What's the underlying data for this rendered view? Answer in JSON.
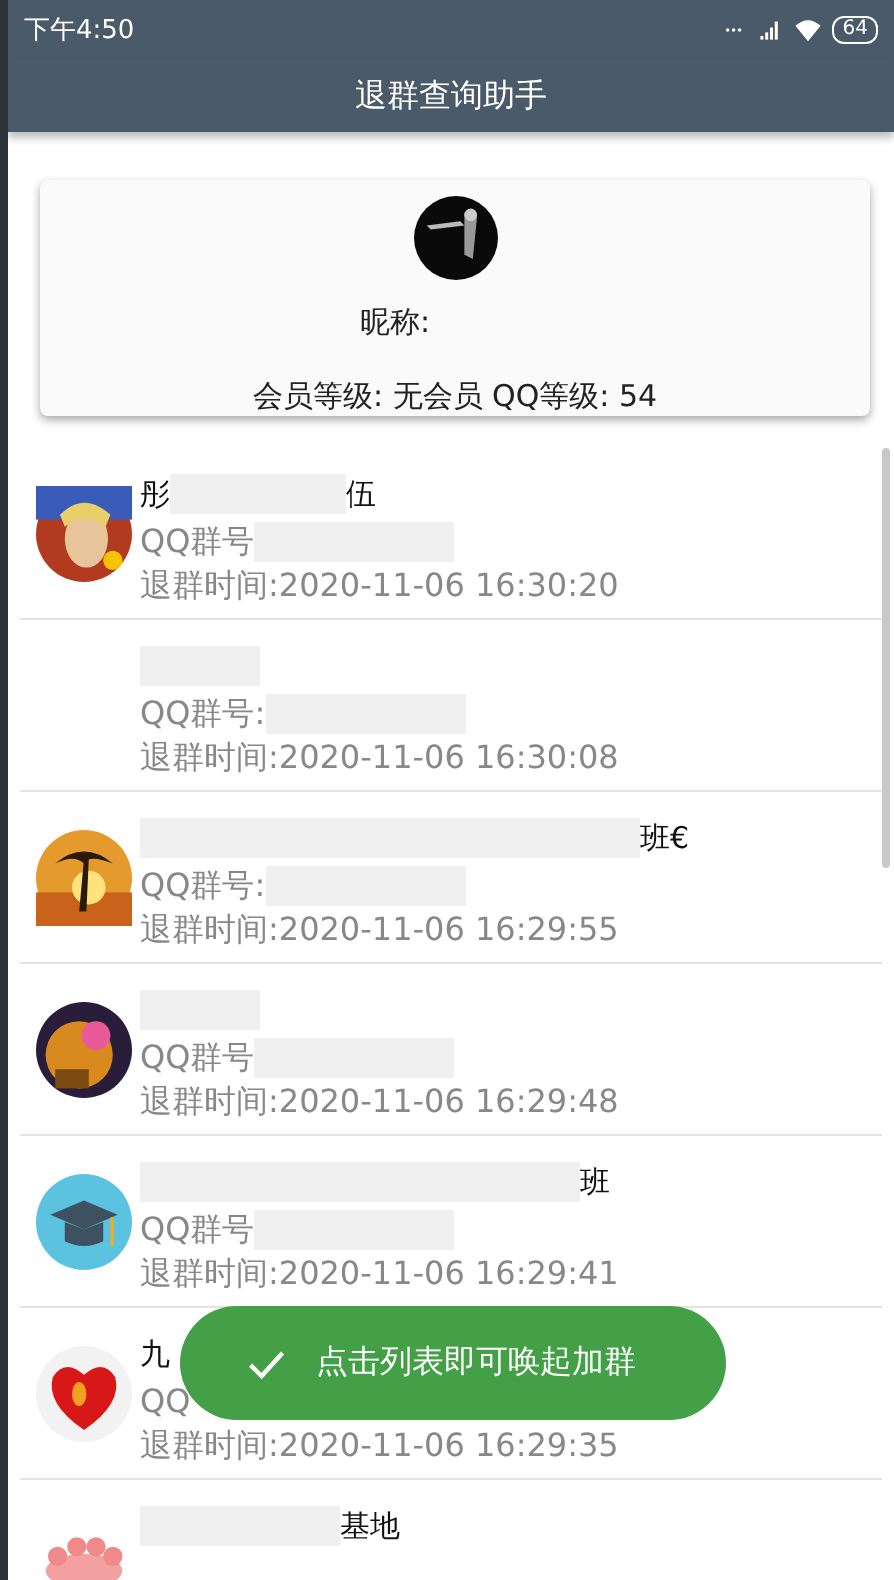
{
  "status_bar": {
    "time": "下午4:50",
    "battery": "64"
  },
  "title": "退群查询助手",
  "profile": {
    "nickname_label": "昵称:",
    "levels": "会员等级: 无会员  QQ等级: 54"
  },
  "groups": [
    {
      "name_start": "彤",
      "name_end": "伍",
      "qq_label": "QQ群号",
      "quit_time": "退群时间:2020-11-06 16:30:20"
    },
    {
      "qq_label": "QQ群号:",
      "quit_time": "退群时间:2020-11-06 16:30:08"
    },
    {
      "name_end": "班€",
      "qq_label": "QQ群号:",
      "quit_time": "退群时间:2020-11-06 16:29:55"
    },
    {
      "qq_label": "QQ群号",
      "quit_time": "退群时间:2020-11-06 16:29:48"
    },
    {
      "name_end": "班",
      "qq_label": "QQ群号",
      "quit_time": "退群时间:2020-11-06 16:29:41"
    },
    {
      "name_start": "九",
      "qq_label": "QQ",
      "quit_time": "退群时间:2020-11-06 16:29:35"
    },
    {
      "name_end": "基地"
    }
  ],
  "toast": {
    "text": "点击列表即可唤起加群"
  }
}
